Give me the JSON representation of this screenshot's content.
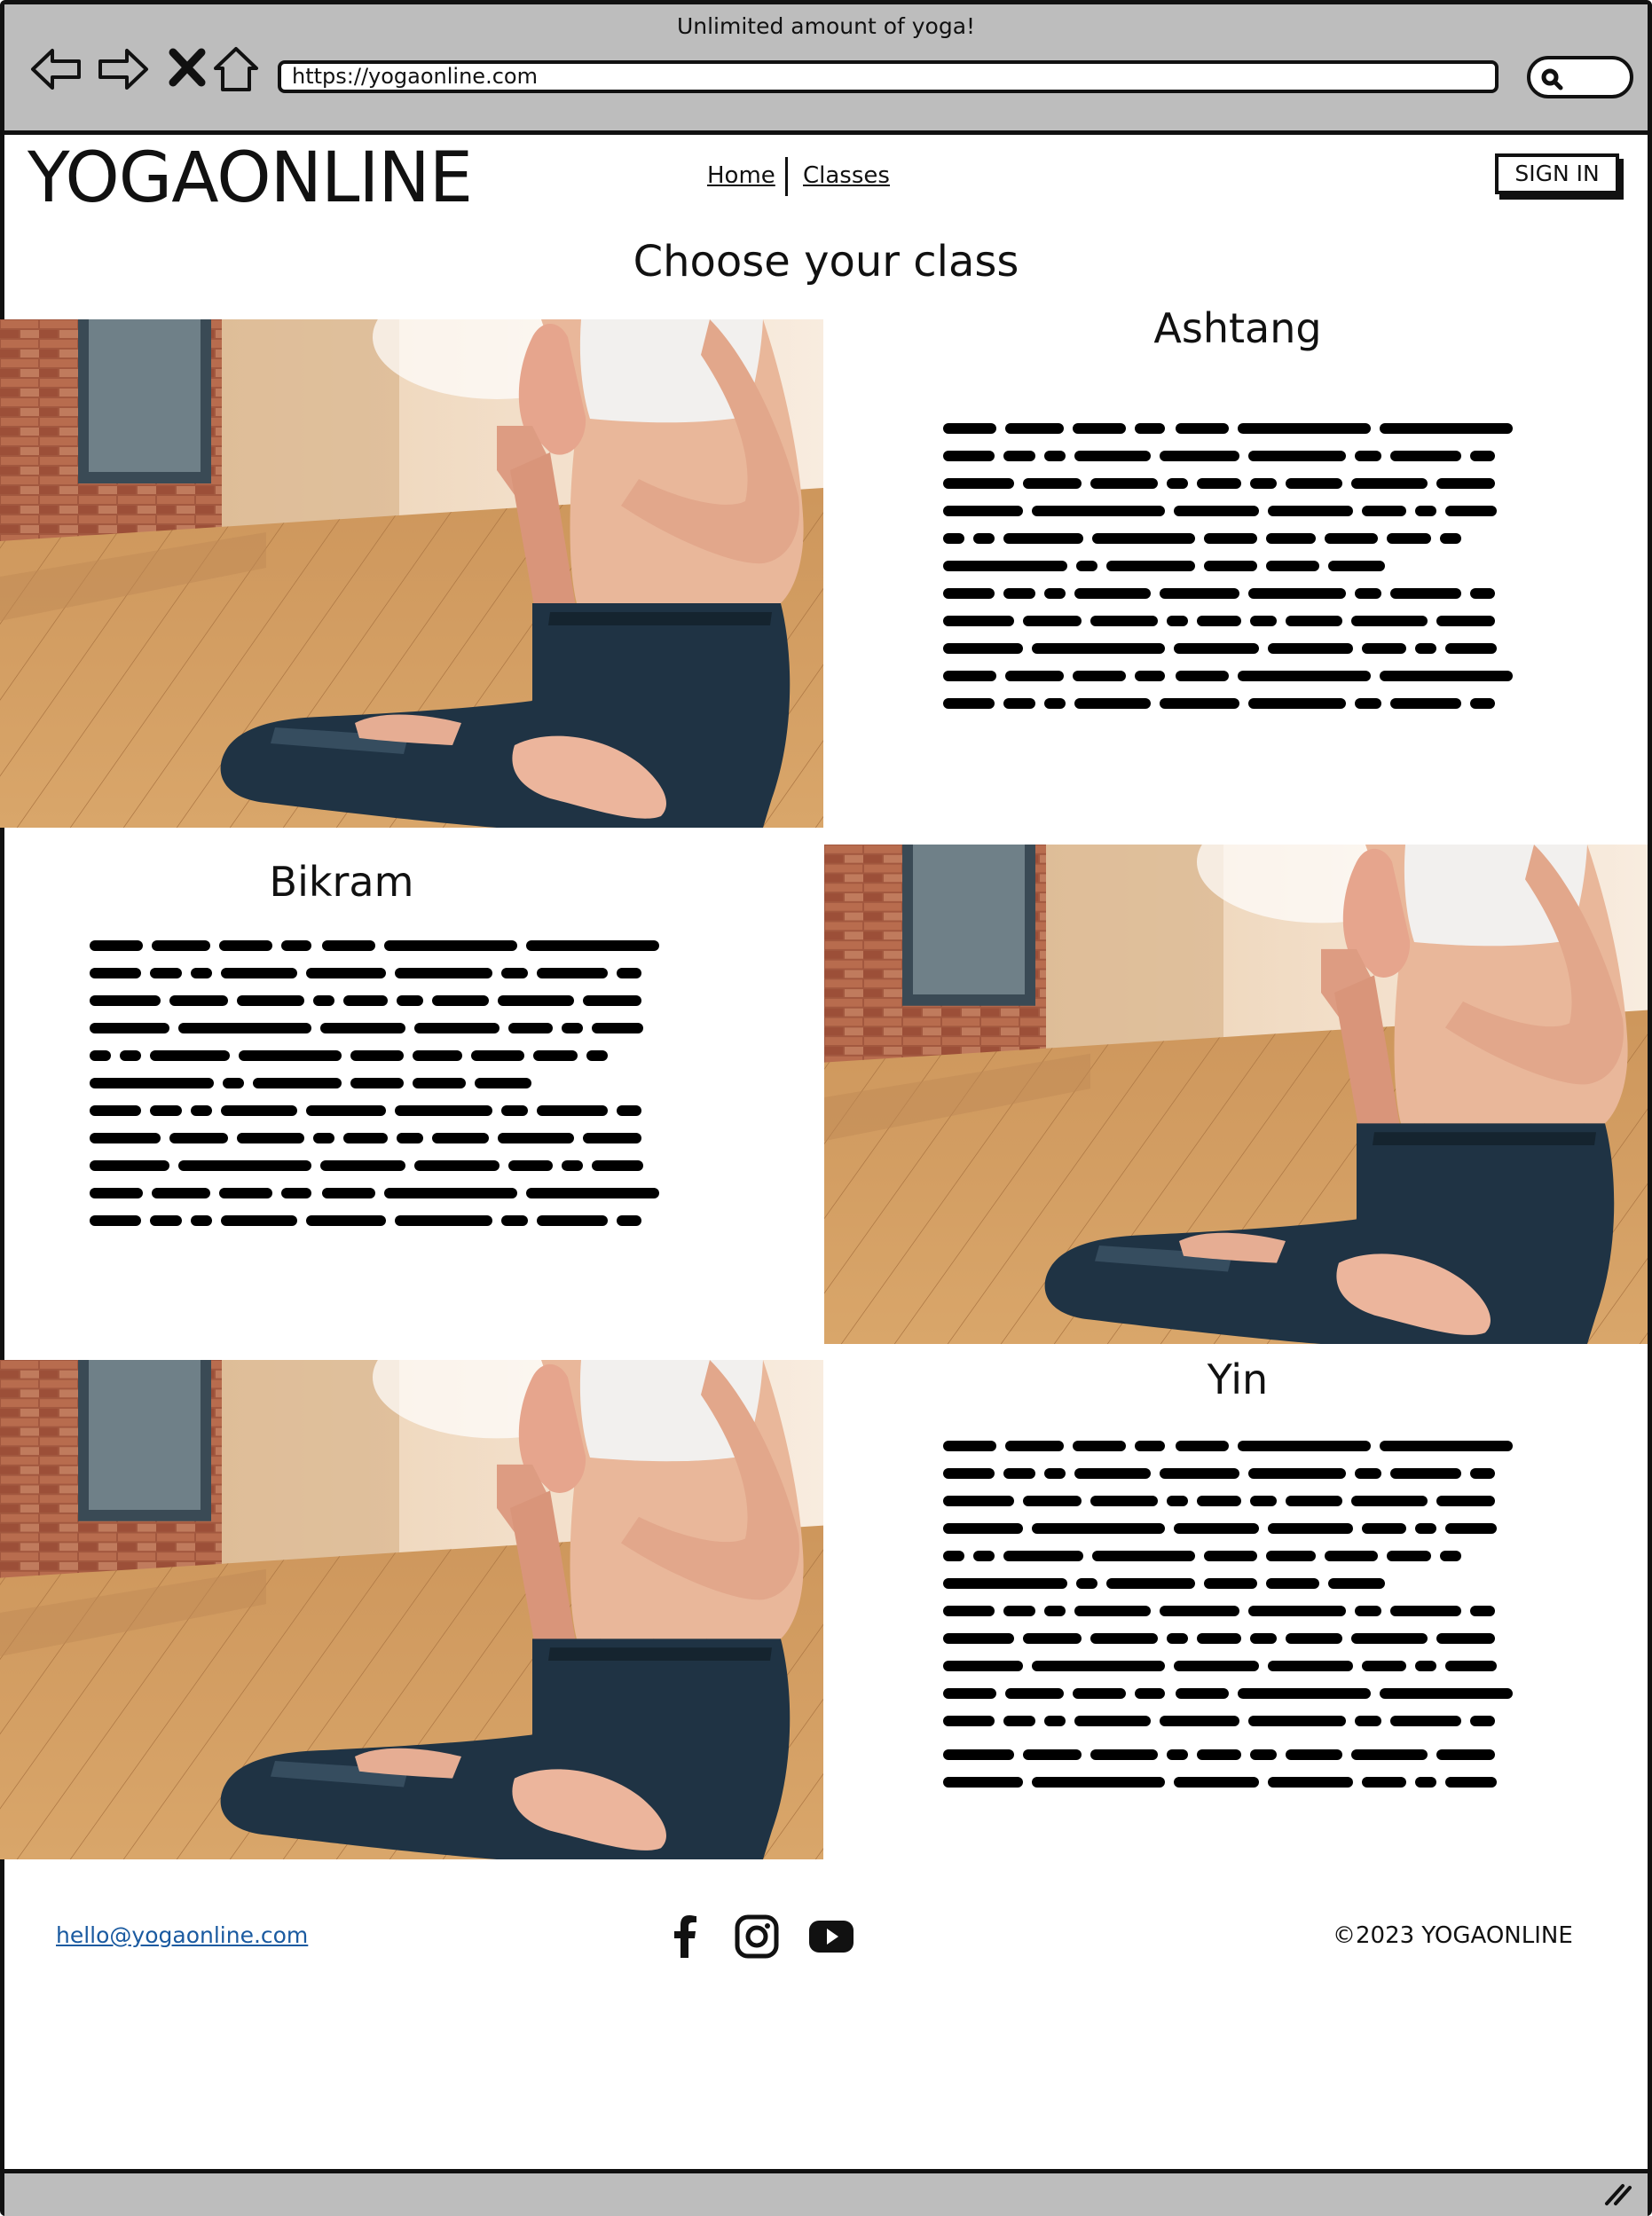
{
  "browser": {
    "title": "Unlimited amount of yoga!",
    "url": "https://yogaonline.com",
    "icons": [
      "back-arrow-icon",
      "forward-arrow-icon",
      "close-icon",
      "home-icon",
      "search-icon"
    ]
  },
  "header": {
    "logo": "YOGAONLINE",
    "nav": [
      {
        "label": "Home"
      },
      {
        "label": "Classes"
      }
    ],
    "signin_label": "SIGN IN"
  },
  "main": {
    "heading": "Choose your class",
    "classes": [
      {
        "title": "Ashtang"
      },
      {
        "title": "Bikram"
      },
      {
        "title": "Yin"
      }
    ]
  },
  "footer": {
    "email": "hello@yogaonline.com",
    "social_icons": [
      "facebook-icon",
      "instagram-icon",
      "youtube-icon"
    ],
    "copyright": "©2023 YOGAONLINE"
  },
  "colors": {
    "chrome": "#bdbdbd",
    "outline": "#111111",
    "link": "#1a5aa0"
  }
}
